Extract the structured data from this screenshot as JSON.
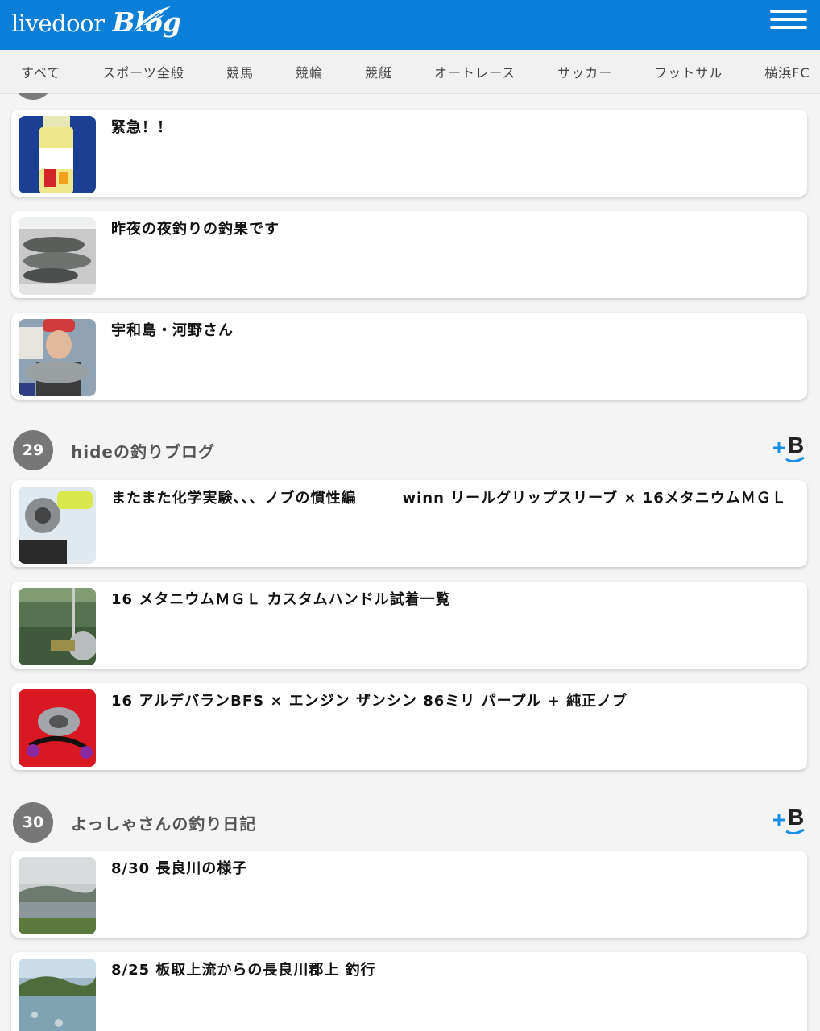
{
  "header": {
    "logo_text": "livedoor",
    "logo_blog": "Blog"
  },
  "tabs": [
    "すべて",
    "スポーツ全般",
    "競馬",
    "競輪",
    "競艇",
    "オートレース",
    "サッカー",
    "フットサル",
    "横浜FC"
  ],
  "prev_section": {
    "posts": [
      {
        "title": "緊急！！"
      },
      {
        "title": "昨夜の夜釣りの釣果です"
      },
      {
        "title": "宇和島・河野さん"
      }
    ]
  },
  "sections": [
    {
      "rank": "29",
      "name": "hideの釣りブログ",
      "posts": [
        {
          "title": "またまた化学実験、、、ノブの慣性編　　　winn リールグリップスリーブ × 16メタニウムＭＧＬ"
        },
        {
          "title": "16 メタニウムＭＧＬ カスタムハンドル試着一覧"
        },
        {
          "title": "16 アルデバランBFS × エンジン ザンシン 86ミリ パープル + 純正ノブ"
        }
      ]
    },
    {
      "rank": "30",
      "name": "よっしゃさんの釣り日記",
      "posts": [
        {
          "title": "8/30 長良川の様子"
        },
        {
          "title": "8/25 板取上流からの長良川郡上 釣行"
        }
      ]
    }
  ],
  "colors": {
    "header_bg": "#0b7fd8",
    "rank_bg": "#777777",
    "hatena_blue": "#1a8fe3"
  }
}
